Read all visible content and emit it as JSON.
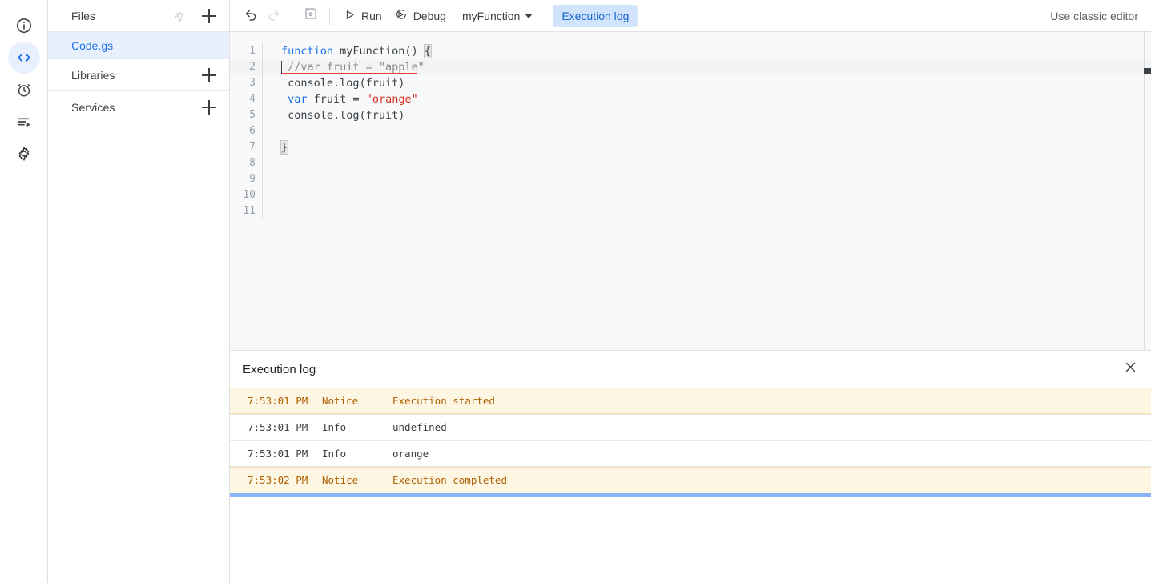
{
  "rail": {
    "items": [
      {
        "name": "overview-icon",
        "label": "Overview",
        "active": false
      },
      {
        "name": "editor-icon",
        "label": "Editor",
        "active": true
      },
      {
        "name": "triggers-icon",
        "label": "Triggers",
        "active": false
      },
      {
        "name": "executions-icon",
        "label": "Executions",
        "active": false
      },
      {
        "name": "settings-icon",
        "label": "Project Settings",
        "active": false
      }
    ]
  },
  "sidebar": {
    "files": {
      "title": "Files",
      "sort_icon": "sort-az-icon",
      "add_icon": "plus-icon",
      "items": [
        {
          "label": "Code.gs",
          "selected": true
        }
      ]
    },
    "libraries": {
      "title": "Libraries",
      "add_icon": "plus-icon"
    },
    "services": {
      "title": "Services",
      "add_icon": "plus-icon"
    }
  },
  "toolbar": {
    "undo_icon": "undo-icon",
    "redo_icon": "redo-icon",
    "save_icon": "save-icon",
    "run_label": "Run",
    "run_icon": "play-icon",
    "debug_label": "Debug",
    "debug_icon": "debug-icon",
    "function_selected": "myFunction",
    "execution_log_tab": "Execution log",
    "classic_editor_link": "Use classic editor"
  },
  "editor": {
    "current_line": 2,
    "lines": [
      {
        "n": "1",
        "tokens": [
          {
            "t": "function",
            "c": "kw"
          },
          {
            "t": " myFunction() ",
            "c": ""
          },
          {
            "t": "{",
            "c": "brace-match"
          }
        ]
      },
      {
        "n": "2",
        "tokens": [
          {
            "t": " //var fruit = \"apple\"",
            "c": "com"
          }
        ],
        "squiggle": true,
        "caret": true
      },
      {
        "n": "3",
        "tokens": [
          {
            "t": " console.log(fruit)",
            "c": ""
          }
        ]
      },
      {
        "n": "4",
        "tokens": [
          {
            "t": " ",
            "c": ""
          },
          {
            "t": "var",
            "c": "kw"
          },
          {
            "t": " fruit = ",
            "c": ""
          },
          {
            "t": "\"orange\"",
            "c": "str"
          }
        ]
      },
      {
        "n": "5",
        "tokens": [
          {
            "t": " console.log(fruit)",
            "c": ""
          }
        ]
      },
      {
        "n": "6",
        "tokens": [
          {
            "t": "",
            "c": ""
          }
        ]
      },
      {
        "n": "7",
        "tokens": [
          {
            "t": "}",
            "c": "brace-match"
          }
        ]
      },
      {
        "n": "8",
        "tokens": [
          {
            "t": "",
            "c": ""
          }
        ]
      },
      {
        "n": "9",
        "tokens": [
          {
            "t": "",
            "c": ""
          }
        ]
      },
      {
        "n": "10",
        "tokens": [
          {
            "t": "",
            "c": ""
          }
        ]
      },
      {
        "n": "11",
        "tokens": [
          {
            "t": "",
            "c": ""
          }
        ]
      }
    ]
  },
  "execution_log": {
    "title": "Execution log",
    "close_icon": "close-icon",
    "rows": [
      {
        "time": "7:53:01 PM",
        "level": "Notice",
        "message": "Execution started",
        "type": "notice"
      },
      {
        "time": "7:53:01 PM",
        "level": "Info",
        "message": "undefined",
        "type": "info"
      },
      {
        "time": "7:53:01 PM",
        "level": "Info",
        "message": "orange",
        "type": "info"
      },
      {
        "time": "7:53:02 PM",
        "level": "Notice",
        "message": "Execution completed",
        "type": "notice"
      }
    ],
    "progress_visible": true
  },
  "colors": {
    "accent": "#1a73e8",
    "tab_bg": "#d2e3fc",
    "tab_fg": "#1967d2",
    "selected_file_bg": "#e8f0fe",
    "notice_bg": "#fdf6e3",
    "notice_fg": "#b06000",
    "editor_bg": "#f8f9fa",
    "string": "#d93025",
    "keyword": "#1a73e8",
    "comment": "#8b8b8b",
    "error_underline": "#ea4335",
    "progress": "#8ab4f8"
  }
}
